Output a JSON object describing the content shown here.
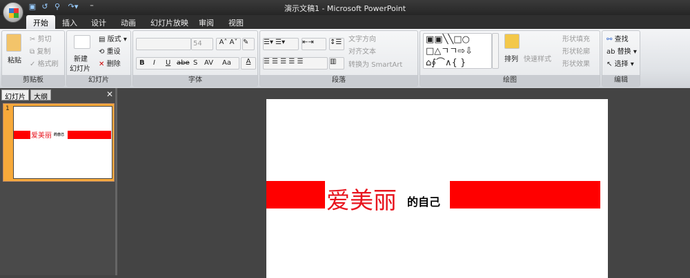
{
  "window": {
    "title": "演示文稿1 - Microsoft PowerPoint"
  },
  "quick_access": {
    "icons": [
      "save-icon",
      "undo-icon",
      "find-icon",
      "redo-icon",
      "customize-icon"
    ]
  },
  "tabs": [
    {
      "label": "开始",
      "active": true
    },
    {
      "label": "插入"
    },
    {
      "label": "设计"
    },
    {
      "label": "动画"
    },
    {
      "label": "幻灯片放映"
    },
    {
      "label": "审阅"
    },
    {
      "label": "视图"
    }
  ],
  "ribbon": {
    "clipboard": {
      "label": "剪贴板",
      "paste": "粘贴",
      "cut": "剪切",
      "copy": "复制",
      "format_painter": "格式刷"
    },
    "slides": {
      "label": "幻灯片",
      "new_slide": "新建",
      "new_slide2": "幻灯片",
      "layout": "版式",
      "reset": "重设",
      "delete": "删除"
    },
    "font": {
      "label": "字体",
      "font_name": "",
      "font_size": "54",
      "bold": "B",
      "italic": "I",
      "underline": "U",
      "strike": "abe",
      "shadow": "S",
      "spacing": "AV",
      "case": "Aa",
      "color": "A"
    },
    "paragraph": {
      "label": "段落",
      "text_direction": "文字方向",
      "align_text": "对齐文本",
      "smartart": "转换为 SmartArt"
    },
    "drawing": {
      "label": "绘图",
      "arrange": "排列",
      "quick_styles": "快速样式",
      "shape_fill": "形状填充",
      "shape_outline": "形状轮廓",
      "shape_effects": "形状效果"
    },
    "editing": {
      "label": "编辑",
      "find": "查找",
      "replace": "替换",
      "select": "选择"
    }
  },
  "panel": {
    "tabs": [
      "幻灯片",
      "大纲"
    ],
    "close": "✕",
    "slide_number": "1"
  },
  "slide": {
    "text_red": "爱美丽",
    "text_black": "的自己",
    "colors": {
      "bar": "#ff0000",
      "text_red": "#e8141e"
    }
  }
}
